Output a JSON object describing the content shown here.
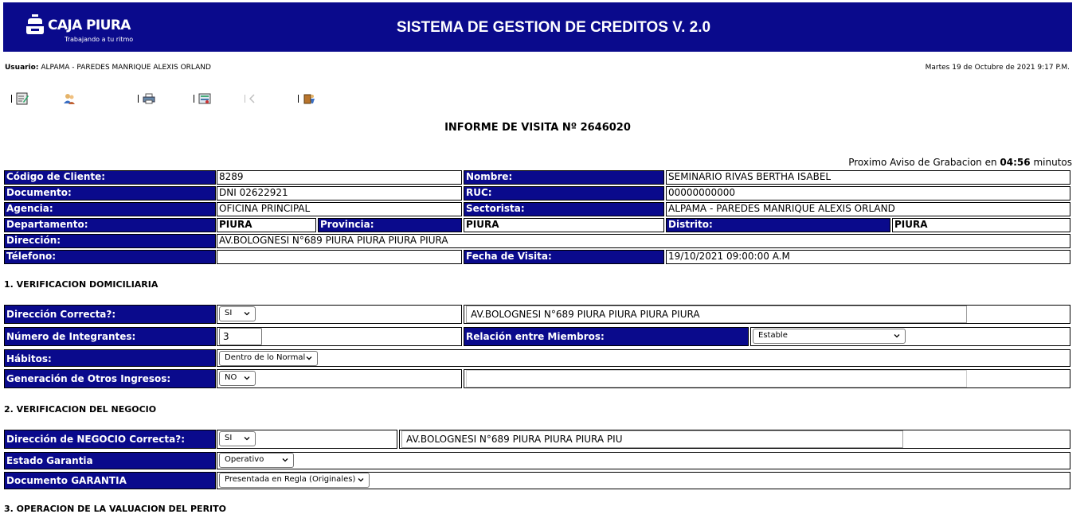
{
  "header": {
    "brand_name": "CAJA PIURA",
    "brand_slogan": "Trabajando a tu ritmo",
    "app_title": "SISTEMA DE GESTION DE CREDITOS V. 2.0"
  },
  "session": {
    "user_label": "Usuario:",
    "user_name": "ALPAMA - PAREDES MANRIQUE ALEXIS ORLAND",
    "datetime": "Martes 19 de Octubre de 2021 9:17 P.M."
  },
  "toolbar": {
    "icons": [
      "edit-icon",
      "users-icon",
      "print-icon",
      "exchange-icon",
      "back-icon",
      "exit-icon"
    ]
  },
  "report": {
    "title": "INFORME DE VISITA Nº 2646020",
    "save_notice_prefix": "Proximo Aviso de Grabacion en",
    "save_notice_time": "04:56",
    "save_notice_suffix": "minutos"
  },
  "client": {
    "codigo_label": "Código de Cliente:",
    "codigo_value": "8289",
    "nombre_label": "Nombre:",
    "nombre_value": "SEMINARIO RIVAS BERTHA ISABEL",
    "documento_label": "Documento:",
    "documento_value": "DNI 02622921",
    "ruc_label": "RUC:",
    "ruc_value": "00000000000",
    "agencia_label": "Agencia:",
    "agencia_value": "OFICINA PRINCIPAL",
    "sectorista_label": "Sectorista:",
    "sectorista_value": "ALPAMA - PAREDES MANRIQUE ALEXIS ORLAND",
    "departamento_label": "Departamento:",
    "departamento_value": "PIURA",
    "provincia_label": "Provincia:",
    "provincia_value": "PIURA",
    "distrito_label": "Distrito:",
    "distrito_value": "PIURA",
    "direccion_label": "Dirección:",
    "direccion_value": "AV.BOLOGNESI N°689 PIURA PIURA PIURA PIURA",
    "telefono_label": "Télefono:",
    "telefono_value": "",
    "fecha_label": "Fecha de Visita:",
    "fecha_value": "19/10/2021 09:00:00 A.M"
  },
  "domicilio": {
    "title": "1. VERIFICACION DOMICILIARIA",
    "dir_correcta_label": "Dirección Correcta?:",
    "dir_correcta_value": "SI",
    "dir_text": "AV.BOLOGNESI N°689 PIURA PIURA PIURA PIURA",
    "integrantes_label": "Número de Integrantes:",
    "integrantes_value": "3",
    "relacion_label": "Relación entre Miembros:",
    "relacion_value": "Estable",
    "habitos_label": "Hábitos:",
    "habitos_value": "Dentro de lo Normal",
    "otros_ingresos_label": "Generación de Otros Ingresos:",
    "otros_ingresos_value": "NO",
    "otros_ingresos_text": ""
  },
  "negocio": {
    "title": "2. VERIFICACION DEL NEGOCIO",
    "dir_correcta_label": "Dirección de NEGOCIO Correcta?:",
    "dir_correcta_value": "SI",
    "dir_text": "AV.BOLOGNESI N°689 PIURA PIURA PIURA PIU",
    "estado_label": "Estado Garantia",
    "estado_value": "Operativo",
    "documento_label": "Documento GARANTIA",
    "documento_value": "Presentada en Regla (Originales)"
  },
  "perito": {
    "title": "3. OPERACION DE LA VALUACION DEL PERITO"
  },
  "colors": {
    "header_bg": "#0a0a8c",
    "label_bg": "#0a0a8c",
    "label_text": "#ffffff"
  }
}
